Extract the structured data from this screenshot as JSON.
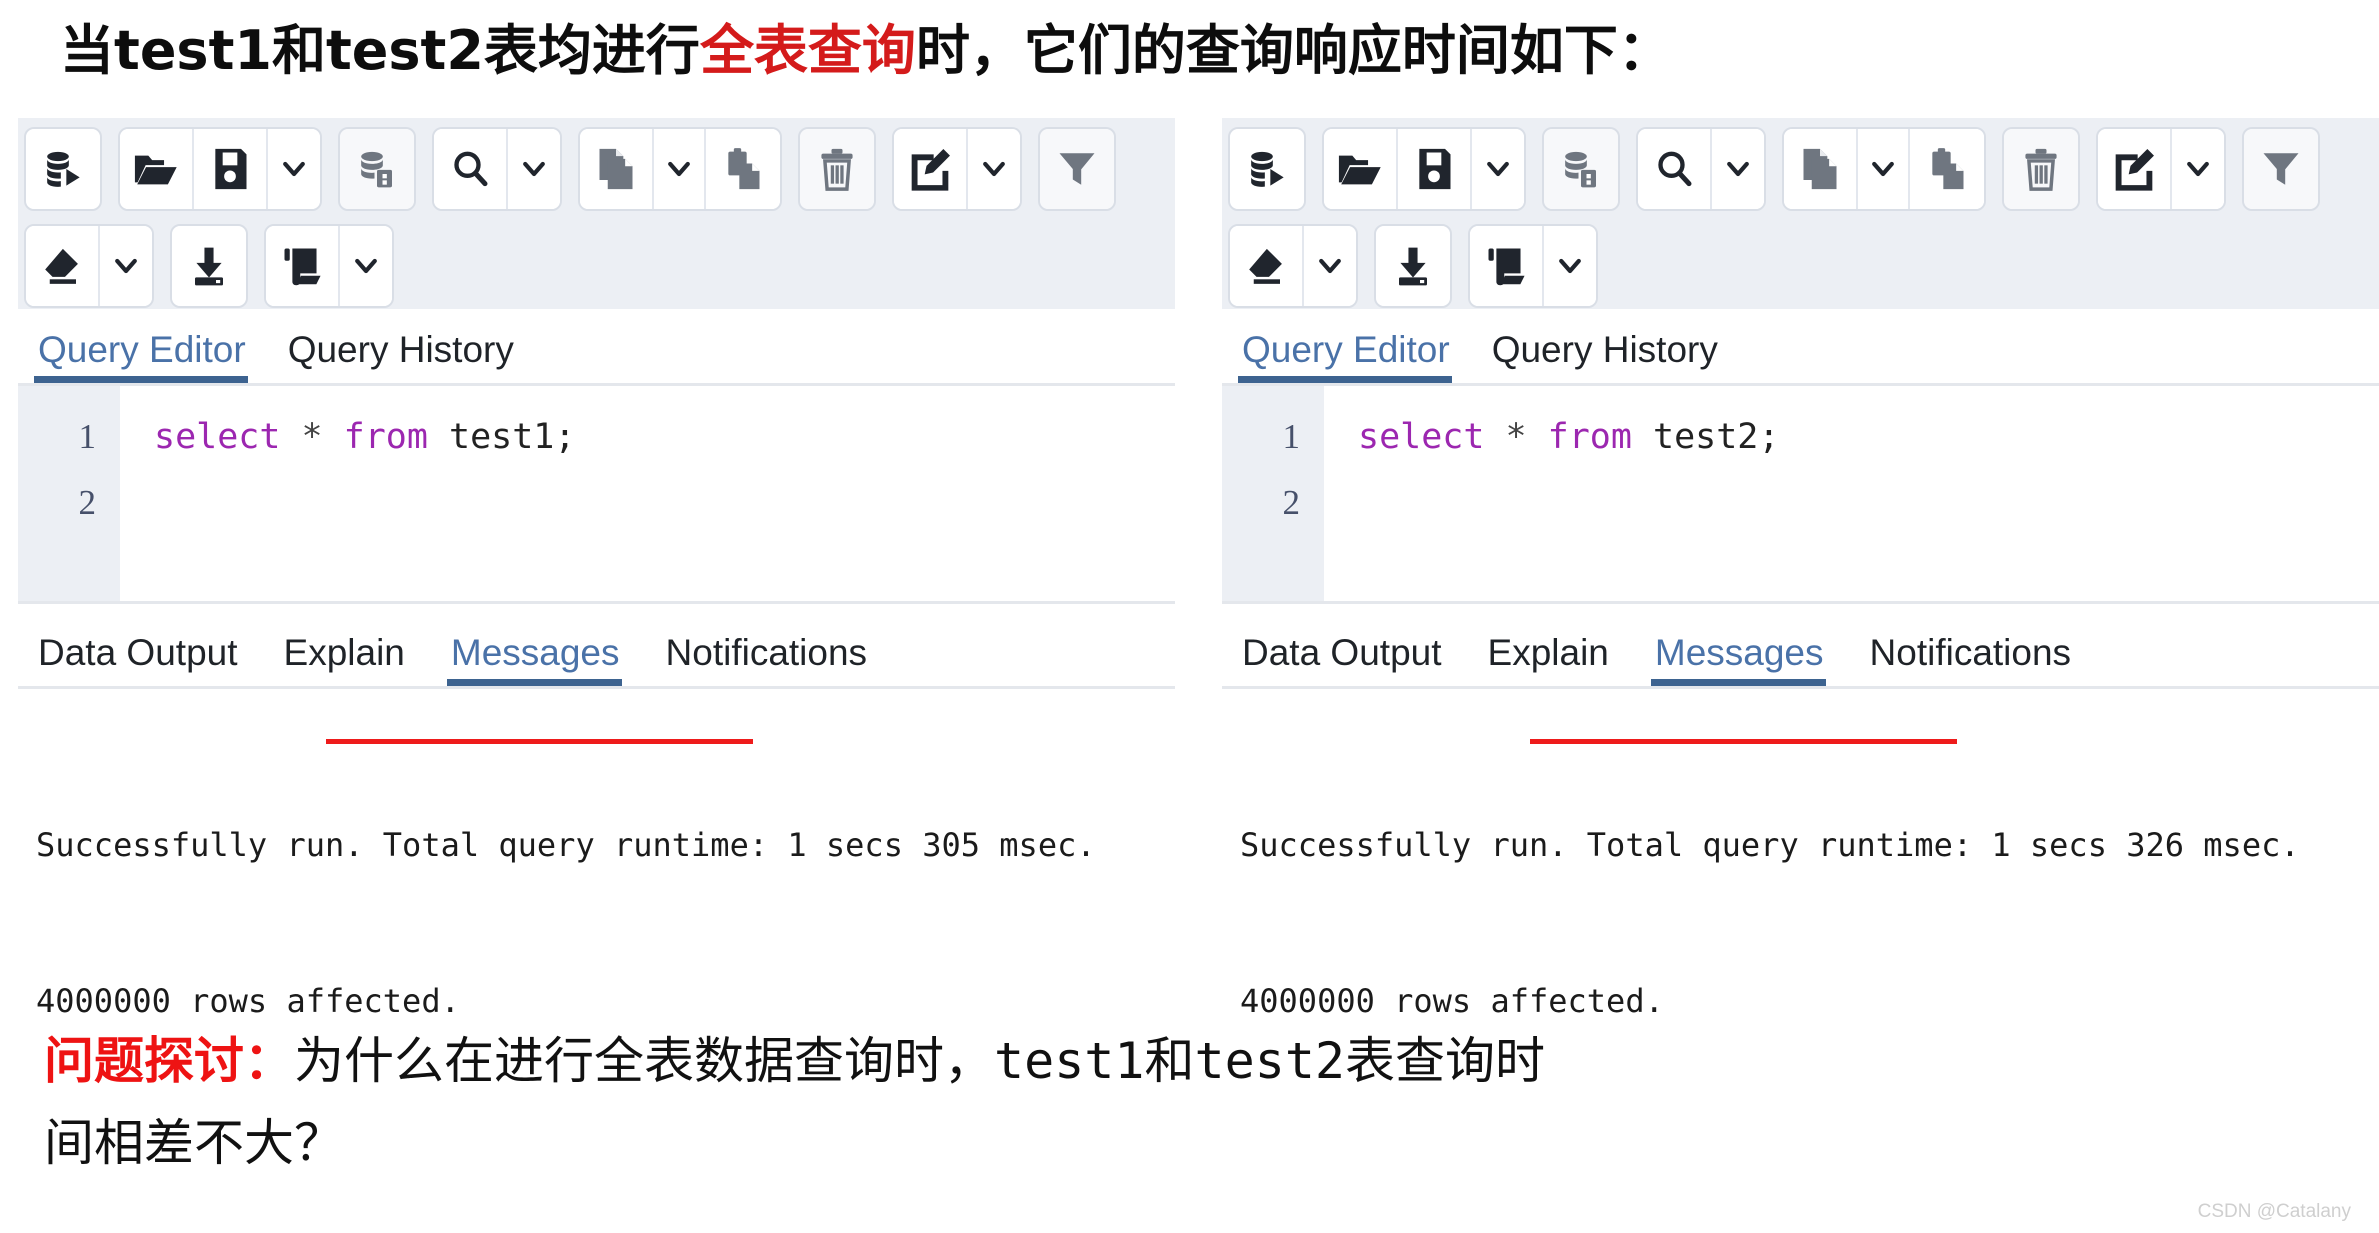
{
  "headline": {
    "part1": "当test1和test2表均进行",
    "highlight": "全表查询",
    "part2": "时，它们的查询响应时间如下："
  },
  "toolbar": {
    "icons": [
      {
        "name": "execute-query-icon",
        "label": "Execute/Refresh"
      },
      {
        "name": "open-file-icon",
        "label": "Open File"
      },
      {
        "name": "save-file-icon",
        "label": "Save File"
      },
      {
        "name": "save-dropdown-caret",
        "label": "Save options"
      },
      {
        "name": "explain-analyze-icon",
        "label": "Explain"
      },
      {
        "name": "find-icon",
        "label": "Find"
      },
      {
        "name": "find-dropdown-caret",
        "label": "Find options"
      },
      {
        "name": "copy-icon",
        "label": "Copy"
      },
      {
        "name": "copy-dropdown-caret",
        "label": "Copy options"
      },
      {
        "name": "paste-icon",
        "label": "Paste"
      },
      {
        "name": "delete-icon",
        "label": "Delete"
      },
      {
        "name": "edit-icon",
        "label": "Edit"
      },
      {
        "name": "edit-dropdown-caret",
        "label": "Edit options"
      },
      {
        "name": "filter-icon",
        "label": "Filter"
      },
      {
        "name": "clear-icon",
        "label": "Clear"
      },
      {
        "name": "clear-dropdown-caret",
        "label": "Clear options"
      },
      {
        "name": "download-icon",
        "label": "Download as CSV"
      },
      {
        "name": "macros-icon",
        "label": "Macros"
      },
      {
        "name": "macros-dropdown-caret",
        "label": "Macro options"
      }
    ]
  },
  "editor_tabs": {
    "query_editor": "Query Editor",
    "query_history": "Query History",
    "active": "Query Editor"
  },
  "output_tabs": {
    "data_output": "Data Output",
    "explain": "Explain",
    "messages": "Messages",
    "notifications": "Notifications",
    "active": "Messages"
  },
  "left_panel": {
    "gutter": [
      "1",
      "2"
    ],
    "sql_keyword_1": "select",
    "sql_operator": " * ",
    "sql_keyword_2": "from",
    "sql_table": " test1;",
    "message_line1": "Successfully run. Total query runtime: 1 secs 305 msec.",
    "message_line2": "4000000 rows affected."
  },
  "right_panel": {
    "gutter": [
      "1",
      "2"
    ],
    "sql_keyword_1": "select",
    "sql_operator": " * ",
    "sql_keyword_2": "from",
    "sql_table": " test2;",
    "message_line1": "Successfully run. Total query runtime: 1 secs 326 msec.",
    "message_line2": "4000000 rows affected."
  },
  "question": {
    "label": "问题探讨：",
    "line1a": "为什么在进行全表数据查询时，",
    "line1b": "test1",
    "line1c": "和",
    "line1d": "test2",
    "line1e": "表查询时",
    "line2": "间相差不大？"
  },
  "watermark": "CSDN @Catalany",
  "colors": {
    "accent_blue": "#3d6390",
    "tab_active_text": "#4a72a8",
    "highlight_red": "#d41b1b",
    "underline_red": "#ee1b1b",
    "sql_keyword": "#9c27b0",
    "toolbar_bg": "#eceff4",
    "gutter_bg": "#eceff4"
  }
}
